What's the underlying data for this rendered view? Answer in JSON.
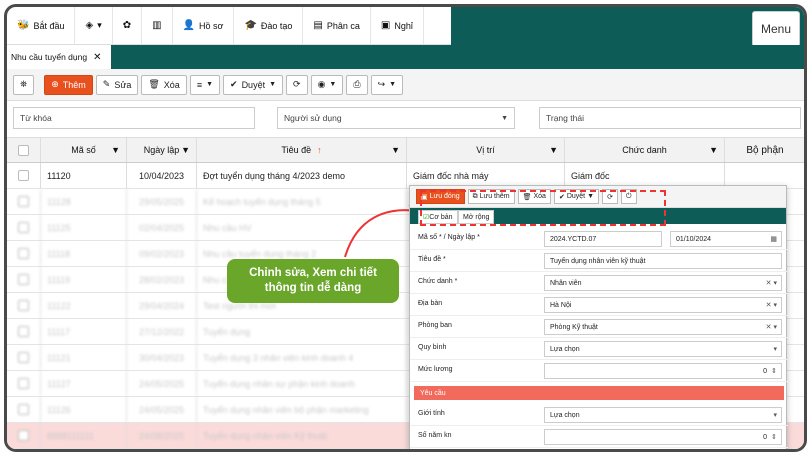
{
  "nav": {
    "items": [
      {
        "icon": "🐝",
        "label": "Bắt đầu"
      },
      {
        "icon": "◈",
        "label": "▾"
      },
      {
        "icon": "✿",
        "label": ""
      },
      {
        "icon": "▥",
        "label": ""
      },
      {
        "icon": "👤",
        "label": "Hồ sơ"
      },
      {
        "icon": "🎓",
        "label": "Đào tạo"
      },
      {
        "icon": "▤",
        "label": "Phân ca"
      },
      {
        "icon": "▣",
        "label": "Nghỉ"
      }
    ],
    "menu_label": "Menu"
  },
  "tab": {
    "label": "Nhu cầu tuyển dụng",
    "close": "✕"
  },
  "toolbar": {
    "binoculars": "⛯",
    "add_label": "Thêm",
    "edit_label": "Sửa",
    "delete_label": "Xóa",
    "menu": "≡",
    "approve_label": "Duyệt",
    "caret": "▼"
  },
  "filters": {
    "keyword": "Từ khóa",
    "user": "Người sử dụng",
    "status": "Trạng thái",
    "dropdown": "▼"
  },
  "grid": {
    "headers": {
      "code": "Mã số",
      "date": "Ngày lập",
      "title": "Tiêu đề",
      "sort": "↑",
      "position": "Vị trí",
      "role": "Chức danh",
      "dept": "Bộ phận"
    },
    "rows": [
      {
        "code": "11120",
        "date": "10/04/2023",
        "title": "Đợt tuyển dụng tháng 4/2023 demo",
        "position": "Giám đốc nhà máy",
        "role": "Giám đốc"
      },
      {
        "code": "11128",
        "date": "29/05/2025",
        "title": "Kế hoạch tuyển dụng tháng 5",
        "position": "",
        "role": ""
      },
      {
        "code": "11125",
        "date": "02/04/2025",
        "title": "Nhu cầu HV",
        "position": "",
        "role": ""
      },
      {
        "code": "11118",
        "date": "09/02/2023",
        "title": "Nhu cầu tuyển dụng tháng 2",
        "position": "",
        "role": ""
      },
      {
        "code": "11119",
        "date": "28/02/2023",
        "title": "Nhu cầu",
        "position": "",
        "role": ""
      },
      {
        "code": "11122",
        "date": "29/04/2024",
        "title": "Test người thi mới",
        "position": "",
        "role": ""
      },
      {
        "code": "11117",
        "date": "27/12/2022",
        "title": "Tuyển dụng",
        "position": "",
        "role": ""
      },
      {
        "code": "11121",
        "date": "30/04/2023",
        "title": "Tuyển dụng 3 nhân viên kinh doanh 4",
        "position": "",
        "role": ""
      },
      {
        "code": "11127",
        "date": "24/05/2025",
        "title": "Tuyển dụng nhân sự phận kinh doanh",
        "position": "",
        "role": ""
      },
      {
        "code": "11126",
        "date": "24/05/2025",
        "title": "Tuyển dụng nhân viên bộ phận marketing",
        "position": "",
        "role": ""
      },
      {
        "code": "8888111111",
        "date": "24/08/2025",
        "title": "Tuyển dụng nhân viên Kỹ thuật",
        "position": "",
        "role": ""
      }
    ]
  },
  "popup": {
    "save_close": "Lưu đóng",
    "save_add": "Lưu thêm",
    "delete": "Xóa",
    "approve": "Duyệt",
    "tab_basic": "Cơ bản",
    "tab_more": "Mở rộng",
    "fields": {
      "code_label": "Mã số * / Ngày lập *",
      "code_value": "2024.YCTD.07",
      "date_value": "01/10/2024",
      "title_label": "Tiêu đề *",
      "title_value": "Tuyển dụng nhân viên kỹ thuật",
      "role_label": "Chức danh *",
      "role_value": "Nhân viên",
      "area_label": "Địa bàn",
      "area_value": "Hà Nội",
      "dept_label": "Phòng ban",
      "dept_value": "Phòng Kỹ thuật",
      "quy_label": "Quy bình",
      "quy_value": "Lựa chọn",
      "salary_label": "Mức lương",
      "salary_value": "0",
      "section_req": "Yêu cầu",
      "gender_label": "Giới tính",
      "gender_value": "Lựa chọn",
      "years_label": "Số năm kn",
      "years_value": "0"
    }
  },
  "callout": {
    "line1": "Chỉnh sửa, Xem chi tiết",
    "line2": "thông tin dễ dàng"
  },
  "colors": {
    "nav": "#0d5c57",
    "primary": "#e8501e",
    "callout": "#6aa629",
    "section": "#f26a5b"
  }
}
